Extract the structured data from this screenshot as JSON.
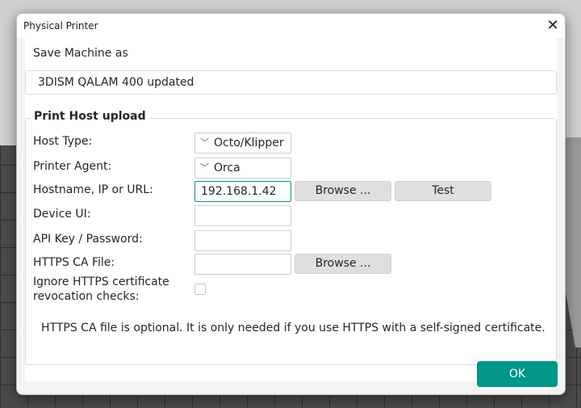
{
  "window": {
    "title": "Physical Printer",
    "close_icon": "close-icon"
  },
  "save": {
    "label": "Save Machine as",
    "value": "3DISM QALAM 400 updated"
  },
  "print_host": {
    "group_title": "Print Host upload",
    "host_type": {
      "label": "Host Type:",
      "value": "Octo/Klipper"
    },
    "printer_agent": {
      "label": "Printer Agent:",
      "value": "Orca"
    },
    "hostname": {
      "label": "Hostname, IP or URL:",
      "value": "192.168.1.42",
      "browse_label": "Browse ...",
      "test_label": "Test"
    },
    "device_ui": {
      "label": "Device UI:",
      "value": ""
    },
    "api_key": {
      "label": "API Key / Password:",
      "value": ""
    },
    "https_ca": {
      "label": "HTTPS CA File:",
      "value": "",
      "browse_label": "Browse ..."
    },
    "ignore_revocation": {
      "label_line1": "Ignore HTTPS certificate",
      "label_line2": "revocation checks:",
      "checked": false
    },
    "note": "HTTPS CA file is optional. It is only needed if you use HTTPS with a self-signed certificate."
  },
  "footer": {
    "ok_label": "OK"
  },
  "colors": {
    "accent": "#009688",
    "dialog_bg": "#f3f3f3",
    "content_bg": "#ffffff"
  }
}
